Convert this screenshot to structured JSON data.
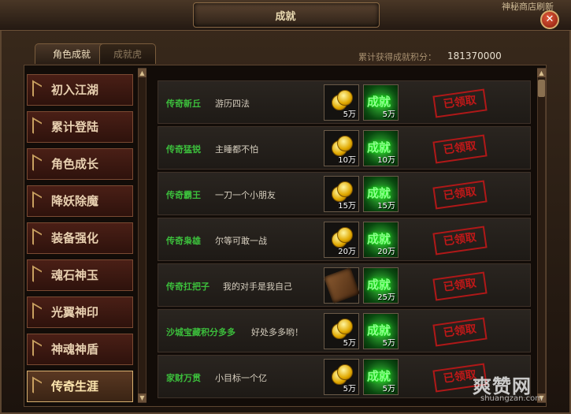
{
  "window": {
    "title": "成就",
    "shop_link": "神秘商店刷新"
  },
  "tabs": [
    {
      "label": "角色成就",
      "active": true
    },
    {
      "label": "成就虎符",
      "active": false
    }
  ],
  "points": {
    "label": "累计获得成就积分：",
    "value": "181370000"
  },
  "sidebar": {
    "items": [
      {
        "label": "初入江湖"
      },
      {
        "label": "累计登陆"
      },
      {
        "label": "角色成长"
      },
      {
        "label": "降妖除魔"
      },
      {
        "label": "装备强化"
      },
      {
        "label": "魂石神玉"
      },
      {
        "label": "光翼神印"
      },
      {
        "label": "神魂神盾"
      },
      {
        "label": "传奇生涯",
        "active": true
      }
    ]
  },
  "achievements": [
    {
      "name": "传奇新丘",
      "desc": "游历四法",
      "reward1_icon": "gold-coin-icon",
      "reward1_amount": "5万",
      "reward2_icon": "achievement-icon",
      "reward2_amount": "5万",
      "status": "已领取"
    },
    {
      "name": "传奇猛锐",
      "desc": "主睡都不怕",
      "reward1_icon": "gold-coin-icon",
      "reward1_amount": "10万",
      "reward2_icon": "achievement-icon",
      "reward2_amount": "10万",
      "status": "已领取"
    },
    {
      "name": "传奇霸王",
      "desc": "一刀一个小朋友",
      "reward1_icon": "gold-coin-icon",
      "reward1_amount": "15万",
      "reward2_icon": "achievement-icon",
      "reward2_amount": "15万",
      "status": "已领取"
    },
    {
      "name": "传奇枭雄",
      "desc": "尔等可敢一战",
      "reward1_icon": "gold-coin-icon",
      "reward1_amount": "20万",
      "reward2_icon": "achievement-icon",
      "reward2_amount": "20万",
      "status": "已领取"
    },
    {
      "name": "传奇扛把子",
      "desc": "我的对手是我自己",
      "reward1_icon": "scroll-item-icon",
      "reward1_amount": "",
      "reward2_icon": "achievement-icon",
      "reward2_amount": "25万",
      "status": "已领取"
    },
    {
      "name": "沙城宝藏积分多多",
      "desc": "好处多多哟！",
      "reward1_icon": "gold-coin-icon",
      "reward1_amount": "5万",
      "reward2_icon": "achievement-icon",
      "reward2_amount": "5万",
      "status": "已领取"
    },
    {
      "name": "家财万贯",
      "desc": "小目标一个亿",
      "reward1_icon": "gold-coin-icon",
      "reward1_amount": "5万",
      "reward2_icon": "achievement-icon",
      "reward2_amount": "5万",
      "status": "已领取"
    }
  ],
  "reward_icon_label": "成就",
  "watermark": {
    "main": "爽赞网",
    "sub": "shuangzan.com"
  }
}
